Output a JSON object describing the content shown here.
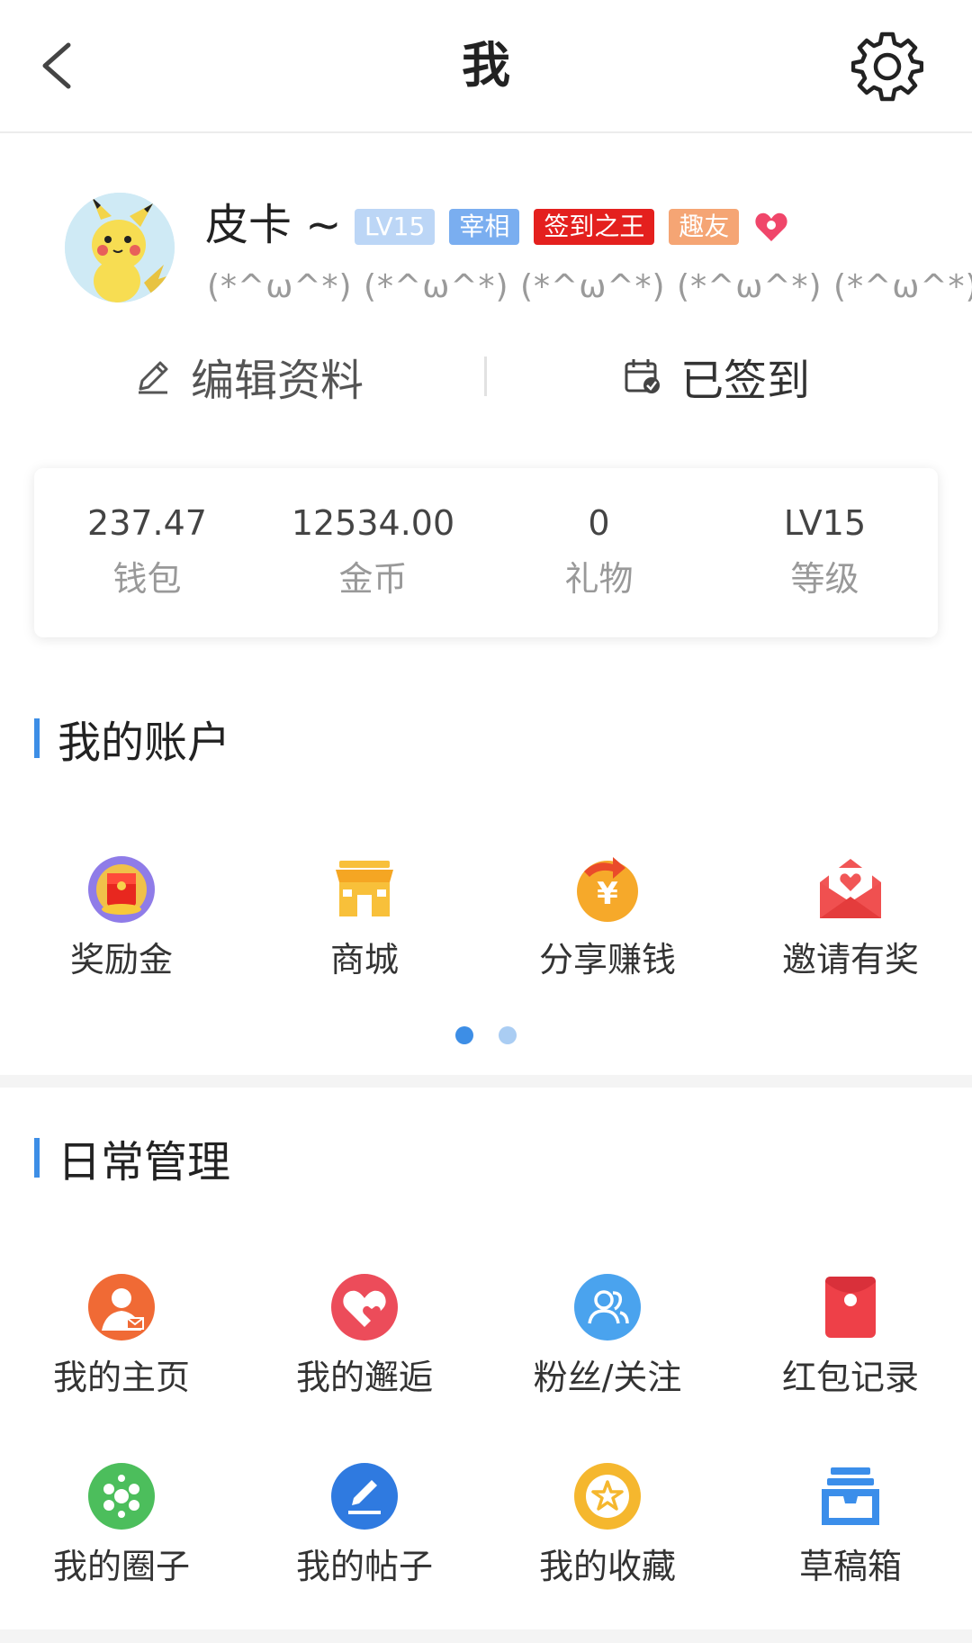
{
  "header": {
    "title": "我"
  },
  "profile": {
    "name": "皮卡 ~",
    "badges": [
      "LV15",
      "宰相",
      "签到之王",
      "趣友"
    ],
    "signature": "(*^ω^*) (*^ω^*) (*^ω^*) (*^ω^*) (*^ω^*)"
  },
  "actions": {
    "edit_label": "编辑资料",
    "signin_label": "已签到"
  },
  "stats": [
    {
      "value": "237.47",
      "label": "钱包"
    },
    {
      "value": "12534.00",
      "label": "金币"
    },
    {
      "value": "0",
      "label": "礼物"
    },
    {
      "value": "LV15",
      "label": "等级"
    }
  ],
  "account": {
    "title": "我的账户",
    "items": [
      {
        "label": "奖励金",
        "icon": "reward-icon"
      },
      {
        "label": "商城",
        "icon": "store-icon"
      },
      {
        "label": "分享赚钱",
        "icon": "share-earn-icon"
      },
      {
        "label": "邀请有奖",
        "icon": "invite-envelope-icon"
      }
    ],
    "pager": {
      "current": 1,
      "total": 2
    }
  },
  "daily": {
    "title": "日常管理",
    "items": [
      {
        "label": "我的主页",
        "icon": "homepage-icon"
      },
      {
        "label": "我的邂逅",
        "icon": "encounter-icon"
      },
      {
        "label": "粉丝/关注",
        "icon": "fans-icon"
      },
      {
        "label": "红包记录",
        "icon": "red-packet-icon"
      },
      {
        "label": "我的圈子",
        "icon": "circle-icon"
      },
      {
        "label": "我的帖子",
        "icon": "posts-icon"
      },
      {
        "label": "我的收藏",
        "icon": "favorites-icon"
      },
      {
        "label": "草稿箱",
        "icon": "drafts-icon"
      }
    ]
  },
  "colors": {
    "accent": "#3d8ee6",
    "badge_red": "#e4201e",
    "badge_orange": "#f5a574",
    "badge_blue": "#7aaef0"
  }
}
